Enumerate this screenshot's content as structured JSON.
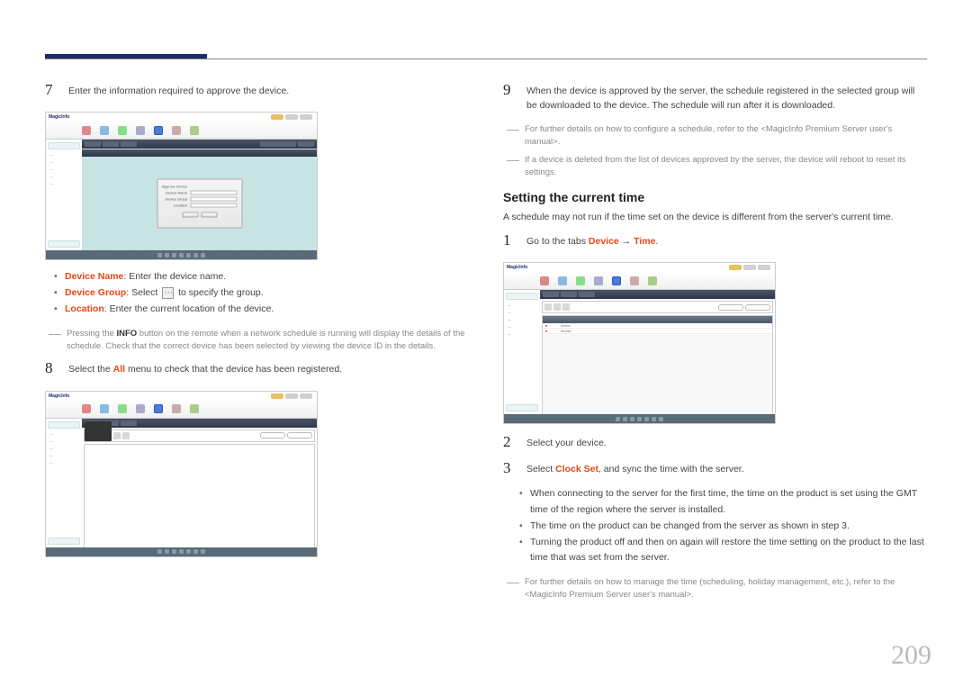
{
  "page_number": "209",
  "left": {
    "step7": {
      "num": "7",
      "text": "Enter the information required to approve the device."
    },
    "screenshot1": {
      "logo": "MagicInfo",
      "dialog": {
        "title": "Approve Device",
        "row1": "Device Name",
        "row2": "Device Group",
        "row3": "Location",
        "ok": "OK",
        "cancel": "Cancel"
      }
    },
    "bullets": {
      "b1_prefix": "Device Name",
      "b1_text": ": Enter the device name.",
      "b2_prefix": "Device Group",
      "b2_text_a": ": Select ",
      "b2_text_b": " to specify the group.",
      "b3_prefix": "Location",
      "b3_text": ": Enter the current location of the device."
    },
    "note1_a": "Pressing the ",
    "note1_b": "INFO",
    "note1_c": " button on the remote when a network schedule is running will display the details of the schedule. Check that the correct device has been selected by viewing the device ID in the details.",
    "step8": {
      "num": "8",
      "text_a": "Select the ",
      "text_b": "All",
      "text_c": " menu to check that the device has been registered."
    },
    "screenshot2": {
      "logo": "MagicInfo"
    }
  },
  "right": {
    "step9": {
      "num": "9",
      "text": "When the device is approved by the server, the schedule registered in the selected group will be downloaded to the device. The schedule will run after it is downloaded."
    },
    "note1": "For further details on how to configure a schedule, refer to the <MagicInfo Premium Server user's manual>.",
    "note2": "If a device is deleted from the list of devices approved by the server, the device will reboot to reset its settings.",
    "heading": "Setting the current time",
    "subtext": "A schedule may not run if the time set on the device is different from the server's current time.",
    "step1": {
      "num": "1",
      "text_a": "Go to the tabs ",
      "text_b": "Device",
      "text_c": " → ",
      "text_d": "Time",
      "text_e": "."
    },
    "screenshot3": {
      "logo": "MagicInfo",
      "row_a": "Device",
      "row_b": "Monitor"
    },
    "step2": {
      "num": "2",
      "text": "Select your device."
    },
    "step3": {
      "num": "3",
      "text_a": "Select ",
      "text_b": "Clock Set",
      "text_c": ", and sync the time with the server."
    },
    "bullets": {
      "b1": "When connecting to the server for the first time, the time on the product is set using the GMT time of the region where the server is installed.",
      "b2": "The time on the product can be changed from the server as shown in step 3.",
      "b3": "Turning the product off and then on again will restore the time setting on the product to the last time that was set from the server."
    },
    "note3": "For further details on how to manage the time (scheduling, holiday management, etc.), refer to the <MagicInfo Premium Server user's manual>."
  }
}
